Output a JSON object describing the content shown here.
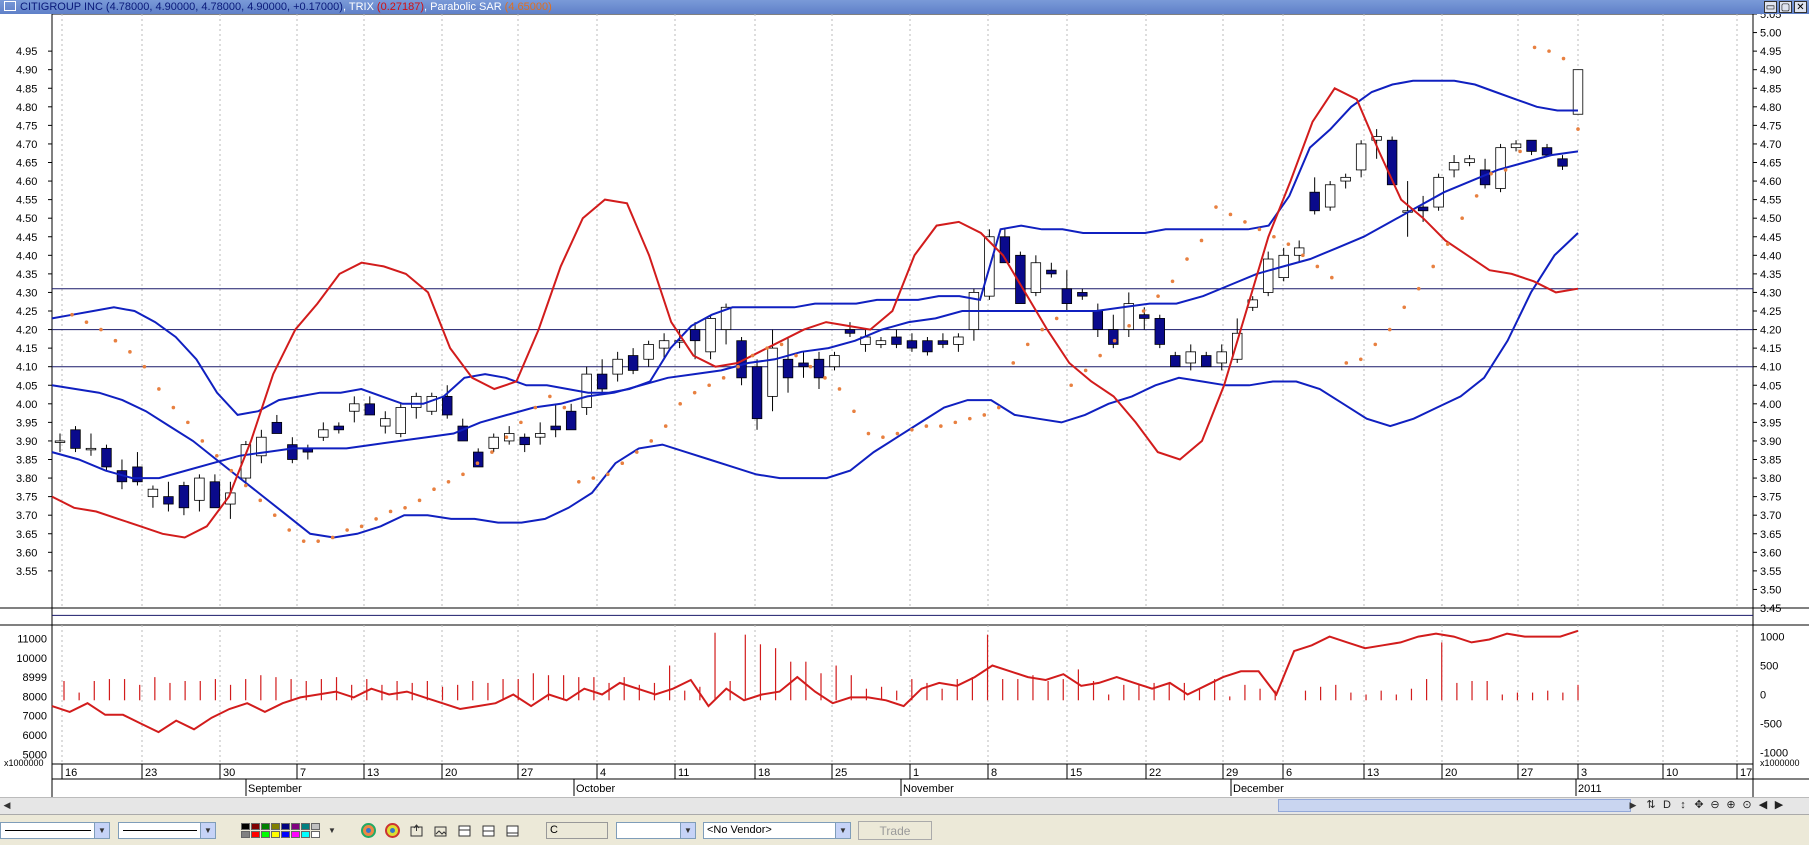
{
  "title_bar": {
    "symbol": "CITIGROUP INC",
    "ohlc": "(4.78000, 4.90000, 4.78000, 4.90000, +0.17000)",
    "trix_label": ", TRIX",
    "trix_value": "(0.27187)",
    "psar_label": ", Parabolic SAR",
    "psar_value": "(4.65000)"
  },
  "window_buttons": [
    "▭",
    "▢",
    "✕"
  ],
  "colors": {
    "price_up": "#ffffff",
    "price_down": "#0a0a8c",
    "bollinger": "#1020c0",
    "trix": "#d21c1c",
    "psar": "#e88040",
    "grid": "#bbbbbb"
  },
  "chart_data": {
    "type": "candlestick",
    "price_axis": {
      "min": 3.45,
      "max": 5.05
    },
    "left_axis_ticks": [
      "4.95",
      "4.90",
      "4.85",
      "4.80",
      "4.75",
      "4.70",
      "4.65",
      "4.60",
      "4.55",
      "4.50",
      "4.45",
      "4.40",
      "4.35",
      "4.30",
      "4.25",
      "4.20",
      "4.15",
      "4.10",
      "4.05",
      "4.00",
      "3.95",
      "3.90",
      "3.85",
      "3.80",
      "3.75",
      "3.70",
      "3.65",
      "3.60",
      "3.55"
    ],
    "right_axis_ticks": [
      "5.05",
      "5.00",
      "4.95",
      "4.90",
      "4.85",
      "4.80",
      "4.75",
      "4.70",
      "4.65",
      "4.60",
      "4.55",
      "4.50",
      "4.45",
      "4.40",
      "4.35",
      "4.30",
      "4.25",
      "4.20",
      "4.15",
      "4.10",
      "4.05",
      "4.00",
      "3.95",
      "3.90",
      "3.85",
      "3.80",
      "3.75",
      "3.70",
      "3.65",
      "3.60",
      "3.55",
      "3.50",
      "3.45"
    ],
    "horizontal_lines": [
      4.31,
      4.2,
      4.1,
      3.43
    ],
    "candles": [
      [
        3.9,
        3.92,
        3.87,
        3.9
      ],
      [
        3.93,
        3.94,
        3.87,
        3.88
      ],
      [
        3.88,
        3.92,
        3.86,
        3.88
      ],
      [
        3.88,
        3.89,
        3.82,
        3.83
      ],
      [
        3.82,
        3.85,
        3.77,
        3.79
      ],
      [
        3.83,
        3.87,
        3.78,
        3.79
      ],
      [
        3.75,
        3.78,
        3.72,
        3.77
      ],
      [
        3.75,
        3.79,
        3.71,
        3.73
      ],
      [
        3.78,
        3.79,
        3.7,
        3.72
      ],
      [
        3.74,
        3.81,
        3.71,
        3.8
      ],
      [
        3.79,
        3.81,
        3.72,
        3.72
      ],
      [
        3.73,
        3.79,
        3.69,
        3.76
      ],
      [
        3.8,
        3.9,
        3.78,
        3.89
      ],
      [
        3.86,
        3.93,
        3.84,
        3.91
      ],
      [
        3.95,
        3.97,
        3.92,
        3.92
      ],
      [
        3.89,
        3.91,
        3.84,
        3.85
      ],
      [
        3.88,
        3.89,
        3.85,
        3.87
      ],
      [
        3.91,
        3.95,
        3.9,
        3.93
      ],
      [
        3.94,
        3.95,
        3.92,
        3.93
      ],
      [
        3.98,
        4.02,
        3.95,
        4.0
      ],
      [
        4.0,
        4.02,
        3.97,
        3.97
      ],
      [
        3.94,
        3.98,
        3.92,
        3.96
      ],
      [
        3.92,
        4.0,
        3.91,
        3.99
      ],
      [
        3.99,
        4.03,
        3.96,
        4.02
      ],
      [
        3.98,
        4.03,
        3.97,
        4.02
      ],
      [
        4.02,
        4.05,
        3.96,
        3.97
      ],
      [
        3.94,
        3.96,
        3.9,
        3.9
      ],
      [
        3.87,
        3.88,
        3.83,
        3.83
      ],
      [
        3.88,
        3.92,
        3.87,
        3.91
      ],
      [
        3.9,
        3.94,
        3.89,
        3.92
      ],
      [
        3.91,
        3.92,
        3.87,
        3.89
      ],
      [
        3.91,
        3.95,
        3.89,
        3.92
      ],
      [
        3.94,
        4.0,
        3.91,
        3.93
      ],
      [
        3.98,
        4.0,
        3.93,
        3.93
      ],
      [
        3.99,
        4.1,
        3.97,
        4.08
      ],
      [
        4.08,
        4.12,
        4.03,
        4.04
      ],
      [
        4.08,
        4.14,
        4.06,
        4.12
      ],
      [
        4.13,
        4.15,
        4.08,
        4.09
      ],
      [
        4.12,
        4.17,
        4.1,
        4.16
      ],
      [
        4.15,
        4.19,
        4.12,
        4.17
      ],
      [
        4.17,
        4.2,
        4.15,
        4.17
      ],
      [
        4.2,
        4.22,
        4.12,
        4.17
      ],
      [
        4.14,
        4.24,
        4.12,
        4.23
      ],
      [
        4.2,
        4.27,
        4.16,
        4.26
      ],
      [
        4.17,
        4.18,
        4.05,
        4.07
      ],
      [
        4.1,
        4.12,
        3.93,
        3.96
      ],
      [
        4.02,
        4.2,
        3.98,
        4.15
      ],
      [
        4.12,
        4.18,
        4.03,
        4.07
      ],
      [
        4.11,
        4.14,
        4.07,
        4.1
      ],
      [
        4.12,
        4.14,
        4.04,
        4.07
      ],
      [
        4.1,
        4.14,
        4.09,
        4.13
      ],
      [
        4.2,
        4.22,
        4.18,
        4.19
      ],
      [
        4.16,
        4.2,
        4.14,
        4.18
      ],
      [
        4.16,
        4.18,
        4.15,
        4.17
      ],
      [
        4.18,
        4.2,
        4.15,
        4.16
      ],
      [
        4.17,
        4.19,
        4.14,
        4.15
      ],
      [
        4.17,
        4.18,
        4.13,
        4.14
      ],
      [
        4.17,
        4.19,
        4.15,
        4.16
      ],
      [
        4.16,
        4.19,
        4.14,
        4.18
      ],
      [
        4.2,
        4.31,
        4.17,
        4.3
      ],
      [
        4.29,
        4.47,
        4.28,
        4.45
      ],
      [
        4.45,
        4.47,
        4.38,
        4.38
      ],
      [
        4.4,
        4.41,
        4.27,
        4.27
      ],
      [
        4.3,
        4.4,
        4.29,
        4.38
      ],
      [
        4.36,
        4.38,
        4.34,
        4.35
      ],
      [
        4.31,
        4.36,
        4.25,
        4.27
      ],
      [
        4.3,
        4.31,
        4.28,
        4.29
      ],
      [
        4.25,
        4.27,
        4.18,
        4.2
      ],
      [
        4.2,
        4.24,
        4.15,
        4.16
      ],
      [
        4.2,
        4.3,
        4.18,
        4.27
      ],
      [
        4.24,
        4.26,
        4.2,
        4.23
      ],
      [
        4.23,
        4.24,
        4.15,
        4.16
      ],
      [
        4.13,
        4.14,
        4.1,
        4.1
      ],
      [
        4.11,
        4.16,
        4.09,
        4.14
      ],
      [
        4.13,
        4.14,
        4.1,
        4.1
      ],
      [
        4.11,
        4.16,
        4.09,
        4.14
      ],
      [
        4.12,
        4.23,
        4.11,
        4.19
      ],
      [
        4.26,
        4.29,
        4.25,
        4.28
      ],
      [
        4.3,
        4.41,
        4.29,
        4.39
      ],
      [
        4.34,
        4.42,
        4.33,
        4.4
      ],
      [
        4.4,
        4.44,
        4.38,
        4.42
      ],
      [
        4.57,
        4.61,
        4.51,
        4.52
      ],
      [
        4.53,
        4.6,
        4.52,
        4.59
      ],
      [
        4.6,
        4.62,
        4.58,
        4.61
      ],
      [
        4.63,
        4.71,
        4.61,
        4.7
      ],
      [
        4.71,
        4.74,
        4.66,
        4.72
      ],
      [
        4.71,
        4.72,
        4.59,
        4.59
      ],
      [
        4.52,
        4.6,
        4.45,
        4.52
      ],
      [
        4.53,
        4.56,
        4.49,
        4.52
      ],
      [
        4.53,
        4.62,
        4.52,
        4.61
      ],
      [
        4.63,
        4.67,
        4.61,
        4.65
      ],
      [
        4.65,
        4.67,
        4.64,
        4.66
      ],
      [
        4.63,
        4.66,
        4.58,
        4.59
      ],
      [
        4.58,
        4.7,
        4.57,
        4.69
      ],
      [
        4.69,
        4.71,
        4.68,
        4.7
      ],
      [
        4.71,
        4.71,
        4.67,
        4.68
      ],
      [
        4.69,
        4.7,
        4.67,
        4.67
      ],
      [
        4.66,
        4.67,
        4.63,
        4.64
      ],
      [
        4.78,
        4.9,
        4.78,
        4.9
      ]
    ],
    "bollinger_upper": [
      4.23,
      4.24,
      4.25,
      4.26,
      4.25,
      4.22,
      4.18,
      4.12,
      4.03,
      3.97,
      3.98,
      4.01,
      4.02,
      4.03,
      4.03,
      4.04,
      4.02,
      4.0,
      4.0,
      4.02,
      4.07,
      4.08,
      4.07,
      4.05,
      4.05,
      4.04,
      4.03,
      4.03,
      4.04,
      4.06,
      4.15,
      4.21,
      4.24,
      4.26,
      4.26,
      4.26,
      4.26,
      4.27,
      4.27,
      4.27,
      4.28,
      4.28,
      4.28,
      4.29,
      4.29,
      4.28,
      4.47,
      4.48,
      4.47,
      4.47,
      4.46,
      4.46,
      4.46,
      4.46,
      4.47,
      4.47,
      4.47,
      4.47,
      4.47,
      4.48,
      4.56,
      4.69,
      4.74,
      4.8,
      4.84,
      4.86,
      4.87,
      4.87,
      4.87,
      4.86,
      4.84,
      4.82,
      4.8,
      4.79,
      4.79
    ],
    "bollinger_middle": [
      3.87,
      3.85,
      3.82,
      3.8,
      3.8,
      3.82,
      3.84,
      3.86,
      3.87,
      3.88,
      3.88,
      3.88,
      3.89,
      3.9,
      3.91,
      3.92,
      3.95,
      3.97,
      3.99,
      4.0,
      4.02,
      4.03,
      4.05,
      4.07,
      4.08,
      4.09,
      4.11,
      4.12,
      4.14,
      4.15,
      4.17,
      4.2,
      4.22,
      4.23,
      4.25,
      4.25,
      4.25,
      4.25,
      4.25,
      4.25,
      4.26,
      4.27,
      4.27,
      4.29,
      4.32,
      4.35,
      4.37,
      4.39,
      4.42,
      4.45,
      4.49,
      4.53,
      4.57,
      4.6,
      4.63,
      4.65,
      4.67,
      4.68
    ],
    "bollinger_lower": [
      4.05,
      4.04,
      4.03,
      4.01,
      3.98,
      3.94,
      3.9,
      3.85,
      3.8,
      3.75,
      3.7,
      3.65,
      3.64,
      3.65,
      3.67,
      3.7,
      3.7,
      3.69,
      3.69,
      3.68,
      3.68,
      3.69,
      3.72,
      3.76,
      3.84,
      3.88,
      3.89,
      3.87,
      3.85,
      3.83,
      3.81,
      3.8,
      3.8,
      3.8,
      3.82,
      3.87,
      3.91,
      3.95,
      3.99,
      4.01,
      4.01,
      3.97,
      3.96,
      3.95,
      3.97,
      4.0,
      4.02,
      4.05,
      4.07,
      4.06,
      4.05,
      4.05,
      4.06,
      4.06,
      4.04,
      4.0,
      3.96,
      3.94,
      3.96,
      3.99,
      4.02,
      4.07,
      4.17,
      4.3,
      4.4,
      4.46
    ],
    "trix_price_overlay": [
      3.75,
      3.72,
      3.71,
      3.69,
      3.67,
      3.65,
      3.64,
      3.67,
      3.75,
      3.9,
      4.08,
      4.2,
      4.27,
      4.35,
      4.38,
      4.37,
      4.35,
      4.3,
      4.15,
      4.07,
      4.04,
      4.06,
      4.2,
      4.37,
      4.5,
      4.55,
      4.54,
      4.4,
      4.22,
      4.13,
      4.1,
      4.11,
      4.14,
      4.17,
      4.2,
      4.22,
      4.21,
      4.2,
      4.25,
      4.4,
      4.48,
      4.49,
      4.46,
      4.4,
      4.3,
      4.2,
      4.11,
      4.06,
      4.02,
      3.95,
      3.87,
      3.85,
      3.9,
      4.05,
      4.25,
      4.45,
      4.6,
      4.76,
      4.85,
      4.82,
      4.68,
      4.55,
      4.5,
      4.44,
      4.4,
      4.36,
      4.35,
      4.33,
      4.3,
      4.31
    ],
    "psar": [
      4.24,
      4.22,
      4.2,
      4.17,
      4.14,
      4.1,
      4.04,
      3.99,
      3.95,
      3.9,
      3.86,
      3.82,
      3.78,
      3.74,
      3.7,
      3.66,
      3.63,
      3.63,
      3.64,
      3.66,
      3.67,
      3.69,
      3.71,
      3.72,
      3.74,
      3.77,
      3.79,
      3.81,
      3.84,
      3.87,
      3.91,
      3.95,
      3.99,
      4.02,
      3.99,
      3.79,
      3.8,
      3.81,
      3.84,
      3.87,
      3.9,
      3.94,
      4.0,
      4.03,
      4.05,
      4.07,
      4.1,
      4.13,
      4.15,
      4.16,
      4.13,
      4.1,
      4.07,
      4.04,
      3.98,
      3.92,
      3.91,
      3.92,
      3.93,
      3.94,
      3.94,
      3.95,
      3.96,
      3.97,
      3.99,
      4.11,
      4.16,
      4.2,
      4.23,
      4.05,
      4.09,
      4.13,
      4.17,
      4.21,
      4.25,
      4.29,
      4.33,
      4.39,
      4.44,
      4.53,
      4.51,
      4.49,
      4.47,
      4.45,
      4.43,
      4.4,
      4.37,
      4.34,
      4.11,
      4.12,
      4.16,
      4.2,
      4.26,
      4.31,
      4.37,
      4.43,
      4.5,
      4.56,
      4.62,
      4.63,
      4.68,
      4.96,
      4.95,
      4.93,
      4.74
    ],
    "volume_axis_ticks": [
      "11000",
      "10000",
      "8999",
      "8000",
      "7000",
      "6000",
      "5000"
    ],
    "volume_scale_label": "x1000000",
    "trix_axis_ticks": [
      "1000",
      "500",
      "0",
      "-500",
      "-1000"
    ],
    "trix_scale_label": "x1000000",
    "volume": [
      8.8,
      8.2,
      8.8,
      8.9,
      8.9,
      8.6,
      9.0,
      8.7,
      8.8,
      8.8,
      8.9,
      8.6,
      8.9,
      9.1,
      9.0,
      8.9,
      8.8,
      8.9,
      9.0,
      8.6,
      8.9,
      8.6,
      8.8,
      8.7,
      8.8,
      8.5,
      8.6,
      8.8,
      8.7,
      8.9,
      8.9,
      9.2,
      9.1,
      9.1,
      9.0,
      9.0,
      8.7,
      9.0,
      8.6,
      8.7,
      9.6,
      8.3,
      8.5,
      11.3,
      8.8,
      11.2,
      10.7,
      10.5,
      9.8,
      9.8,
      9.2,
      9.6,
      9.1,
      8.4,
      8.5,
      8.3,
      8.9,
      8.7,
      8.4,
      8.9,
      9.0,
      11.2,
      8.9,
      8.9,
      9.1,
      8.8,
      8.9,
      9.4,
      8.8,
      8.1,
      8.6,
      8.6,
      8.7,
      8.7,
      8.7,
      8.4,
      8.9,
      8.0,
      8.6,
      8.4,
      8.3,
      7.8,
      8.3,
      8.5,
      8.6,
      8.2,
      8.1,
      8.3,
      8.1,
      8.4,
      8.9,
      10.8,
      8.7,
      8.8,
      8.8,
      8.1,
      8.2,
      8.2,
      8.3,
      8.2,
      8.6
    ],
    "trix_oscillator": [
      -200,
      -300,
      -150,
      -350,
      -350,
      -500,
      -650,
      -450,
      -600,
      -400,
      -250,
      -150,
      -300,
      -150,
      -50,
      0,
      50,
      -50,
      100,
      0,
      50,
      -50,
      -150,
      -250,
      -200,
      -150,
      0,
      -200,
      0,
      -100,
      100,
      0,
      200,
      100,
      0,
      100,
      250,
      -200,
      100,
      -100,
      0,
      50,
      300,
      50,
      -150,
      -50,
      -50,
      -100,
      -200,
      100,
      200,
      150,
      300,
      500,
      400,
      300,
      250,
      350,
      150,
      200,
      300,
      200,
      100,
      200,
      0,
      150,
      300,
      400,
      400,
      0,
      750,
      850,
      1000,
      900,
      800,
      850,
      900,
      1000,
      1050,
      1000,
      900,
      950,
      1050,
      1000,
      1000,
      1000,
      1100
    ]
  },
  "date_labels": [
    "16",
    "23",
    "30",
    "7",
    "13",
    "20",
    "27",
    "4",
    "11",
    "18",
    "25",
    "1",
    "8",
    "15",
    "22",
    "29",
    "6",
    "13",
    "20",
    "27",
    "3",
    "10",
    "17"
  ],
  "month_labels": [
    "September",
    "October",
    "November",
    "December",
    "2011"
  ],
  "scrollbar": {
    "left_arrow": "◀",
    "right_arrow": "▶"
  },
  "nav_buttons": [
    "⇅",
    "D",
    "↕",
    "✥",
    "⊖",
    "⊕",
    "⊙",
    "◀",
    "▶"
  ],
  "toolbar": {
    "line_style_1": "",
    "line_style_2": "",
    "color_swatches": [
      "#000000",
      "#800000",
      "#008000",
      "#808000",
      "#000080",
      "#800080",
      "#008080",
      "#c0c0c0",
      "#808080",
      "#ff0000",
      "#00ff00",
      "#ffff00",
      "#0000ff",
      "#ff00ff",
      "#00ffff",
      "#ffffff"
    ],
    "symbol_value": "C",
    "period_value": "",
    "vendor_value": "<No Vendor>",
    "trade_label": "Trade"
  }
}
